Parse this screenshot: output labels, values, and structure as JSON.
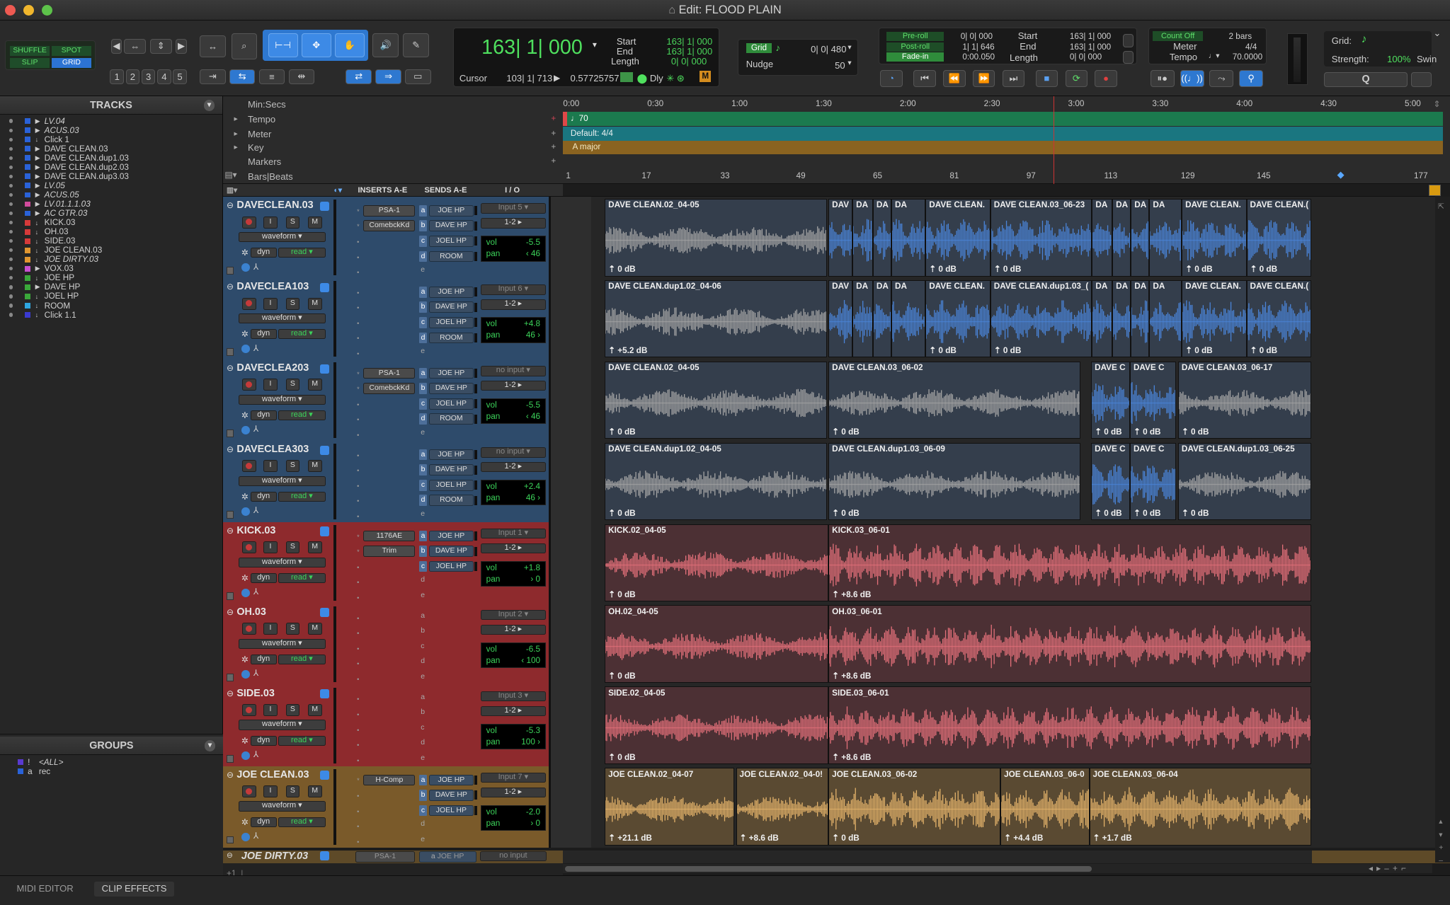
{
  "window": {
    "title": "Edit: FLOOD PLAIN"
  },
  "toolbar": {
    "modes": {
      "shuffle": "SHUFFLE",
      "spot": "SPOT",
      "slip": "SLIP",
      "grid": "GRID"
    },
    "zoom_presets": [
      "1",
      "2",
      "3",
      "4",
      "5"
    ],
    "counter": {
      "main": "163| 1| 000",
      "start_label": "Start",
      "start": "163| 1| 000",
      "end_label": "End",
      "end": "163| 1| 000",
      "length_label": "Length",
      "length": "0| 0| 000"
    },
    "cursor": {
      "label": "Cursor",
      "value": "103| 1| 713",
      "sample": "0.57725757",
      "dly": "Dly",
      "m": "M"
    },
    "grid": {
      "label": "Grid",
      "value": "0| 0| 480"
    },
    "nudge": {
      "label": "Nudge",
      "value": "50"
    },
    "transport_fields": {
      "preroll_label": "Pre-roll",
      "preroll": "0| 0| 000",
      "postroll_label": "Post-roll",
      "postroll": "1| 1| 646",
      "fadein_label": "Fade-in",
      "fadein": "0:00.050",
      "start_label": "Start",
      "start": "163| 1| 000",
      "end_label": "End",
      "end": "163| 1| 000",
      "length_label": "Length",
      "length": "0| 0| 000"
    },
    "count": {
      "label": "Count Off",
      "value": "2 bars",
      "meter_label": "Meter",
      "meter": "4/4",
      "tempo_label": "Tempo",
      "tempo": "70.0000"
    },
    "grid_right": {
      "label": "Grid:",
      "strength_label": "Strength:",
      "strength": "100%",
      "swing_label": "Swin"
    },
    "quantize": "Q"
  },
  "tracks_panel": {
    "title": "TRACKS",
    "items": [
      {
        "name": "LV.04",
        "color": "#2a62d8",
        "italic": true
      },
      {
        "name": "ACUS.03",
        "color": "#2a62d8",
        "italic": true
      },
      {
        "name": "Click 1",
        "color": "#2a62d8",
        "italic": false
      },
      {
        "name": "DAVE CLEAN.03",
        "color": "#2a62d8",
        "italic": false
      },
      {
        "name": "DAVE CLEAN.dup1.03",
        "color": "#2a62d8",
        "italic": false
      },
      {
        "name": "DAVE CLEAN.dup2.03",
        "color": "#2a62d8",
        "italic": false
      },
      {
        "name": "DAVE CLEAN.dup3.03",
        "color": "#2a62d8",
        "italic": false
      },
      {
        "name": "LV.05",
        "color": "#2a62d8",
        "italic": true
      },
      {
        "name": "ACUS.05",
        "color": "#2a62d8",
        "italic": true
      },
      {
        "name": "LV.01.1.1.03",
        "color": "#d24b9c",
        "italic": true
      },
      {
        "name": "AC GTR.03",
        "color": "#2a62d8",
        "italic": true
      },
      {
        "name": "KICK.03",
        "color": "#d63a3a",
        "italic": false
      },
      {
        "name": "OH.03",
        "color": "#d63a3a",
        "italic": false
      },
      {
        "name": "SIDE.03",
        "color": "#d63a3a",
        "italic": false
      },
      {
        "name": "JOE CLEAN.03",
        "color": "#e09630",
        "italic": false
      },
      {
        "name": "JOE DIRTY.03",
        "color": "#e09630",
        "italic": true
      },
      {
        "name": "VOX.03",
        "color": "#c84fd0",
        "italic": false
      },
      {
        "name": "JOE HP",
        "color": "#3aa83a",
        "italic": false
      },
      {
        "name": "DAVE HP",
        "color": "#3aa83a",
        "italic": false
      },
      {
        "name": "JOEL HP",
        "color": "#3aa83a",
        "italic": false
      },
      {
        "name": "ROOM",
        "color": "#2ea6e0",
        "italic": false
      },
      {
        "name": "Click 1.1",
        "color": "#3a3ad0",
        "italic": false
      }
    ]
  },
  "groups_panel": {
    "title": "GROUPS",
    "items": [
      {
        "id": "!",
        "name": "<ALL>"
      },
      {
        "id": "a",
        "name": "rec"
      }
    ]
  },
  "rulers": {
    "labels": [
      "Min:Secs",
      "Tempo",
      "Meter",
      "Key",
      "Markers",
      "Bars|Beats"
    ],
    "minsecs": [
      "0:00",
      "0:30",
      "1:00",
      "1:30",
      "2:00",
      "2:30",
      "3:00",
      "3:30",
      "4:00",
      "4:30",
      "5:00"
    ],
    "bars": [
      "1",
      "17",
      "33",
      "49",
      "65",
      "81",
      "97",
      "113",
      "129",
      "145",
      "177"
    ],
    "tempo": "70",
    "meter": "Default: 4/4",
    "key": "A major"
  },
  "columns": {
    "inserts": "INSERTS A-E",
    "sends": "SENDS A-E",
    "io": "I / O"
  },
  "tracks": [
    {
      "name": "DAVECLEAN.03",
      "type": "blue",
      "inserts": [
        "PSA-1",
        "ComebckKd"
      ],
      "sends": [
        "JOE HP",
        "DAVE HP",
        "JOEL HP",
        "ROOM"
      ],
      "io_in": "Input 5",
      "io_out": "1-2",
      "vol": "-5.5",
      "pan": "‹ 46",
      "view": "waveform",
      "auto": "read",
      "dyn": "dyn",
      "clips": [
        {
          "n": "DAVE CLEAN.02_04-05",
          "g": "0 dB"
        },
        {
          "n": "DAV",
          "g": ""
        },
        {
          "n": "DA",
          "g": ""
        },
        {
          "n": "DA",
          "g": ""
        },
        {
          "n": "DA",
          "g": ""
        },
        {
          "n": "DAVE CLEAN.",
          "g": "0 dB"
        },
        {
          "n": "DAVE CLEAN.03_06-23",
          "g": "0 dB"
        },
        {
          "n": "DA",
          "g": ""
        },
        {
          "n": "DA",
          "g": ""
        },
        {
          "n": "DA",
          "g": ""
        },
        {
          "n": "DA",
          "g": ""
        },
        {
          "n": "DAVE CLEAN.",
          "g": "0 dB"
        },
        {
          "n": "DAVE CLEAN.(",
          "g": "0 dB"
        }
      ]
    },
    {
      "name": "DAVECLEA103",
      "type": "blue",
      "inserts": [],
      "sends": [
        "JOE HP",
        "DAVE HP",
        "JOEL HP",
        "ROOM"
      ],
      "io_in": "Input 6",
      "io_out": "1-2",
      "vol": "+4.8",
      "pan": "46 ›",
      "view": "waveform",
      "auto": "read",
      "dyn": "dyn",
      "clips": [
        {
          "n": "DAVE CLEAN.dup1.02_04-06",
          "g": "+5.2 dB"
        },
        {
          "n": "DAV",
          "g": ""
        },
        {
          "n": "DA",
          "g": ""
        },
        {
          "n": "DA",
          "g": ""
        },
        {
          "n": "DA",
          "g": ""
        },
        {
          "n": "DAVE CLEAN.",
          "g": "0 dB"
        },
        {
          "n": "DAVE CLEAN.dup1.03_(",
          "g": "0 dB"
        },
        {
          "n": "DA",
          "g": ""
        },
        {
          "n": "DA",
          "g": ""
        },
        {
          "n": "DA",
          "g": ""
        },
        {
          "n": "DA",
          "g": ""
        },
        {
          "n": "DAVE CLEAN.",
          "g": "0 dB"
        },
        {
          "n": "DAVE CLEAN.(",
          "g": "0 dB"
        }
      ]
    },
    {
      "name": "DAVECLEA203",
      "type": "blue",
      "inserts": [
        "PSA-1",
        "ComebckKd"
      ],
      "sends": [
        "JOE HP",
        "DAVE HP",
        "JOEL HP",
        "ROOM"
      ],
      "io_in": "no input",
      "io_out": "1-2",
      "vol": "-5.5",
      "pan": "‹ 46",
      "view": "waveform",
      "auto": "read",
      "dyn": "dyn",
      "clips": [
        {
          "n": "DAVE CLEAN.02_04-05",
          "g": "0 dB"
        },
        {
          "n": "DAVE CLEAN.03_06-02",
          "g": "0 dB"
        },
        {
          "n": "DAVE C",
          "g": "0 dB"
        },
        {
          "n": "DAVE C",
          "g": "0 dB"
        },
        {
          "n": "DAVE CLEAN.03_06-17",
          "g": "0 dB"
        }
      ]
    },
    {
      "name": "DAVECLEA303",
      "type": "blue",
      "inserts": [],
      "sends": [
        "JOE HP",
        "DAVE HP",
        "JOEL HP",
        "ROOM"
      ],
      "io_in": "no input",
      "io_out": "1-2",
      "vol": "+2.4",
      "pan": "46 ›",
      "view": "waveform",
      "auto": "read",
      "dyn": "dyn",
      "clips": [
        {
          "n": "DAVE CLEAN.dup1.02_04-05",
          "g": "0 dB"
        },
        {
          "n": "DAVE CLEAN.dup1.03_06-09",
          "g": "0 dB"
        },
        {
          "n": "DAVE C",
          "g": "0 dB"
        },
        {
          "n": "DAVE C",
          "g": "0 dB"
        },
        {
          "n": "DAVE CLEAN.dup1.03_06-25",
          "g": "0 dB"
        }
      ]
    },
    {
      "name": "KICK.03",
      "type": "red",
      "inserts": [
        "1176AE",
        "Trim"
      ],
      "sends": [
        "JOE HP",
        "DAVE HP",
        "JOEL HP"
      ],
      "io_in": "Input 1",
      "io_out": "1-2",
      "vol": "+1.8",
      "pan": "› 0",
      "view": "waveform",
      "auto": "read",
      "dyn": "dyn",
      "clips": [
        {
          "n": "KICK.02_04-05",
          "g": "0 dB"
        },
        {
          "n": "KICK.03_06-01",
          "g": "+8.6 dB"
        }
      ]
    },
    {
      "name": "OH.03",
      "type": "red",
      "inserts": [],
      "sends": [],
      "io_in": "Input 2",
      "io_out": "1-2",
      "vol": "-6.5",
      "pan": "‹ 100",
      "view": "waveform",
      "auto": "read",
      "dyn": "dyn",
      "clips": [
        {
          "n": "OH.02_04-05",
          "g": "0 dB"
        },
        {
          "n": "OH.03_06-01",
          "g": "+8.6 dB"
        }
      ]
    },
    {
      "name": "SIDE.03",
      "type": "red",
      "inserts": [],
      "sends": [],
      "io_in": "Input 3",
      "io_out": "1-2",
      "vol": "-5.3",
      "pan": "100 ›",
      "view": "waveform",
      "auto": "read",
      "dyn": "dyn",
      "clips": [
        {
          "n": "SIDE.02_04-05",
          "g": "0 dB"
        },
        {
          "n": "SIDE.03_06-01",
          "g": "+8.6 dB"
        }
      ]
    },
    {
      "name": "JOE CLEAN.03",
      "type": "orange",
      "inserts": [
        "H-Comp"
      ],
      "sends": [
        "JOE HP",
        "DAVE HP",
        "JOEL HP"
      ],
      "io_in": "Input 7",
      "io_out": "1-2",
      "vol": "-2.0",
      "pan": "› 0",
      "view": "waveform",
      "auto": "read",
      "dyn": "dyn",
      "clips": [
        {
          "n": "JOE CLEAN.02_04-07",
          "g": "+21.1 dB"
        },
        {
          "n": "JOE CLEAN.02_04-0!",
          "g": "+8.6 dB"
        },
        {
          "n": "JOE CLEAN.03_06-02",
          "g": "0 dB"
        },
        {
          "n": "JOE CLEAN.03_06-0",
          "g": "+4.4 dB"
        },
        {
          "n": "JOE CLEAN.03_06-04",
          "g": "+1.7 dB"
        }
      ]
    }
  ],
  "partial_track": {
    "name": "JOE DIRTY.03",
    "insert": "PSA-1",
    "send": "JOE HP",
    "io": "no input"
  },
  "bottom_tabs": [
    "MIDI EDITOR",
    "CLIP EFFECTS"
  ]
}
